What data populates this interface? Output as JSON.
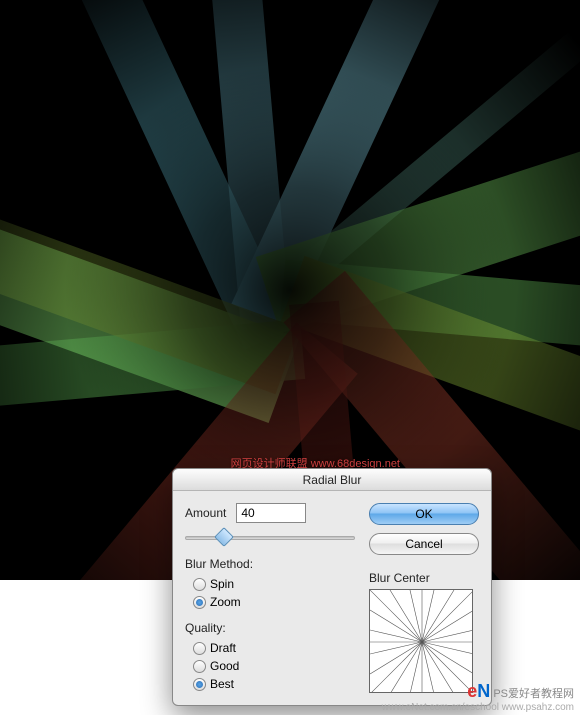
{
  "dialog": {
    "title": "Radial Blur",
    "amount_label": "Amount",
    "amount_value": "40",
    "method_label": "Blur Method:",
    "method_options": {
      "spin": "Spin",
      "zoom": "Zoom"
    },
    "method_selected": "zoom",
    "quality_label": "Quality:",
    "quality_options": {
      "draft": "Draft",
      "good": "Good",
      "best": "Best"
    },
    "quality_selected": "best",
    "blur_center_label": "Blur Center",
    "ok_label": "OK",
    "cancel_label": "Cancel"
  },
  "watermarks": {
    "top": "网页设计师联盟  www.68design.net",
    "bottom_line1_a": "e",
    "bottom_line1_b": "N",
    "bottom_line1_c": "PS爱好者教程网",
    "bottom_line2": "www.eNet.com.cn/eschool  www.psahz.com"
  }
}
